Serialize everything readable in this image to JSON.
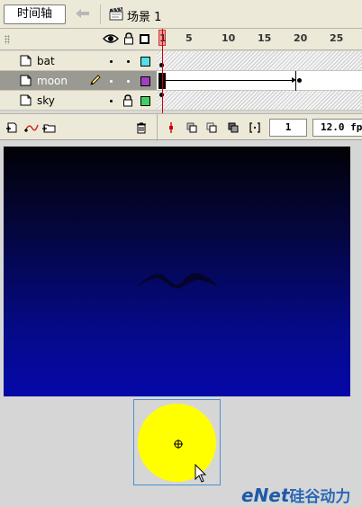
{
  "toolbar": {
    "timeline_tab": "时间轴",
    "scene_label": "场景 1",
    "icons": [
      "back-arrow-icon",
      "scene-clapper-icon"
    ]
  },
  "timeline": {
    "header_icons": [
      "eye-icon",
      "lock-icon",
      "outline-icon"
    ],
    "ruler_labels": [
      "1",
      "5",
      "10",
      "15",
      "20",
      "25"
    ],
    "layers": [
      {
        "name": "bat",
        "color": "#55e0e8",
        "locked": false,
        "selected": false
      },
      {
        "name": "moon",
        "color": "#a040c0",
        "locked": false,
        "selected": true
      },
      {
        "name": "sky",
        "color": "#40d060",
        "locked": true,
        "selected": false
      }
    ],
    "current_frame": "1",
    "frame_rate": "12.0 fps"
  },
  "watermark": {
    "brand": "eNet",
    "cn": "硅谷动力"
  },
  "colors": {
    "playhead": "#cc0000",
    "selected_layer_bg": "#9a9a92",
    "moon_yellow": "#ffff00",
    "sky_top": "#020206",
    "sky_bottom": "#0508a8"
  }
}
